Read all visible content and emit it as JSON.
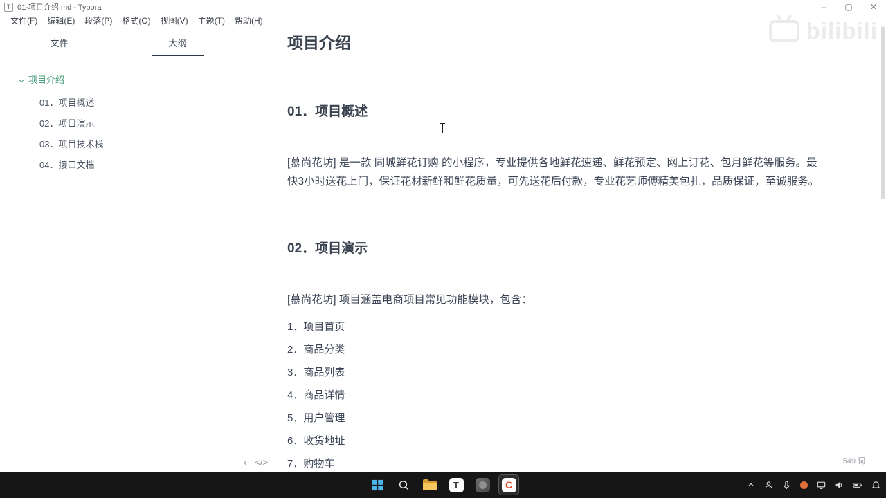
{
  "titlebar": {
    "title": "01-项目介绍.md - Typora",
    "app_initial": "T",
    "minimize": "–",
    "maximize": "▢",
    "close": "✕"
  },
  "menubar": {
    "items": [
      "文件(F)",
      "编辑(E)",
      "段落(P)",
      "格式(O)",
      "视图(V)",
      "主题(T)",
      "帮助(H)"
    ]
  },
  "sidebar": {
    "tabs": {
      "files": "文件",
      "outline": "大纲"
    },
    "outline_root": "项目介绍",
    "outline_items": [
      "01．项目概述",
      "02．项目演示",
      "03．项目技术栈",
      "04．接口文档"
    ]
  },
  "document": {
    "title": "项目介绍",
    "section1_heading": "01．项目概述",
    "section1_body": "[慕尚花坊] 是一款 同城鲜花订购 的小程序，专业提供各地鲜花速递、鲜花预定、网上订花、包月鲜花等服务。最快3小时送花上门，保证花材新鲜和鲜花质量，可先送花后付款，专业花艺师傅精美包扎，品质保证，至诚服务。",
    "section2_heading": "02．项目演示",
    "section2_body": "[慕尚花坊] 项目涵盖电商项目常见功能模块，包含：",
    "list": [
      "1．项目首页",
      "2．商品分类",
      "3．商品列表",
      "4．商品详情",
      "5．用户管理",
      "6．收货地址",
      "7．购物车"
    ]
  },
  "statusbar": {
    "back_icon": "‹",
    "source_icon": "</>",
    "word_count": "549 词"
  },
  "watermark": {
    "text": "bilibili"
  },
  "taskbar": {
    "typora_letter": "T",
    "recorder_letter": "C"
  },
  "colors": {
    "outline_active": "#4aa17c",
    "recorder_c": "#e8502a",
    "start_blue": "#4cb4e8",
    "taskbar_bg": "#161616"
  }
}
